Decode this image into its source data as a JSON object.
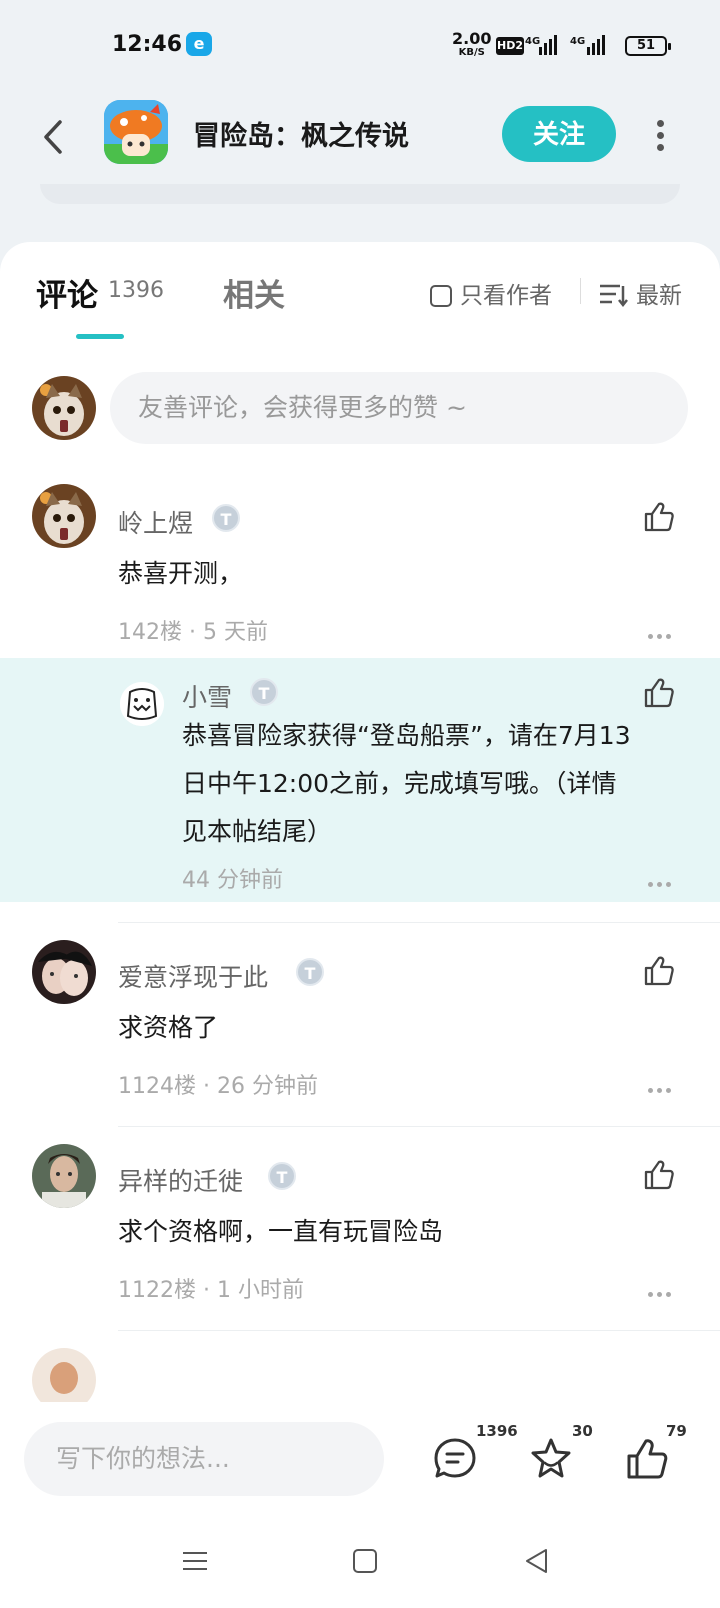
{
  "status_bar": {
    "time": "12:46",
    "app_icon": "e",
    "speed_value": "2.00",
    "speed_unit": "KB/S",
    "hd_label": "HD2",
    "network_1": "4G",
    "network_2": "4G",
    "battery": "51"
  },
  "header": {
    "title": "冒险岛：枫之传说",
    "follow_label": "关注"
  },
  "tabs": {
    "comments_label": "评论",
    "comments_count": "1396",
    "related_label": "相关",
    "author_only_label": "只看作者",
    "sort_label": "最新"
  },
  "comment_box": {
    "placeholder": "友善评论，会获得更多的赞 ~"
  },
  "comments": [
    {
      "user": "岭上煜",
      "badge": "T",
      "text": "恭喜开测，",
      "meta": "142楼 · 5 天前",
      "reply": {
        "user": "小雪",
        "badge": "T",
        "text_line1": "恭喜冒险家获得“登岛船票”，请在7月13",
        "text_line2": "日中午12:00之前，完成填写哦。（详情",
        "text_line3": "见本帖结尾）",
        "meta": "44 分钟前"
      }
    },
    {
      "user": "爱意浮现于此",
      "badge": "T",
      "text": "求资格了",
      "meta": "1124楼 · 26 分钟前"
    },
    {
      "user": "异样的迁徙",
      "badge": "T",
      "text": "求个资格啊，一直有玩冒险岛",
      "meta": "1122楼 · 1 小时前"
    }
  ],
  "bottom_bar": {
    "placeholder": "写下你的想法...",
    "comment_count": "1396",
    "favorite_count": "30",
    "like_count": "79"
  },
  "colors": {
    "accent": "#25c0c4",
    "reply_bg": "#e6f6f6"
  }
}
